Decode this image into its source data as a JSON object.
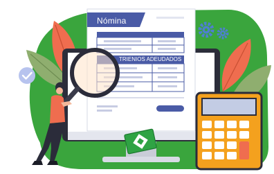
{
  "document": {
    "title": "Nómina",
    "table_header": "TRIENIOS ADEUDADOS"
  },
  "colors": {
    "accent_blue": "#4a5ba6",
    "blob_green": "#3aa53d",
    "leaf_coral": "#ef6d4f",
    "leaf_olive": "#8fae6f",
    "gear_blue": "#4e7fd0",
    "calculator_orange": "#f4a11e",
    "screen_frame": "#2c2d3a"
  },
  "icons": [
    "check-circle-icon",
    "gear-icon",
    "magnifier-icon",
    "euro-banknote-icon",
    "calculator-icon"
  ]
}
